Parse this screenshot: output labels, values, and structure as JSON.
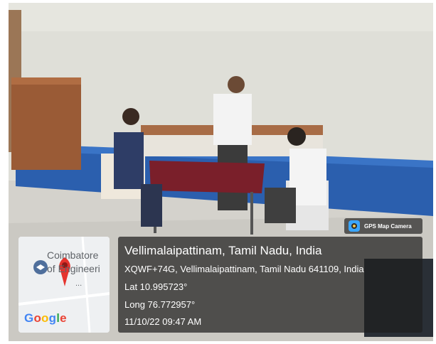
{
  "badge": {
    "label": "GPS Map Camera",
    "icon": "gps-map-camera-icon"
  },
  "map": {
    "place_line1": "Coimbatore",
    "place_line2": "of Engineeri",
    "dots": "...",
    "logo": [
      "G",
      "o",
      "o",
      "g",
      "l",
      "e"
    ],
    "logo_colors": [
      "#4285F4",
      "#EA4335",
      "#FBBC05",
      "#4285F4",
      "#34A853",
      "#EA4335"
    ],
    "pin_color": "#E5342E"
  },
  "info": {
    "title": "Vellimalaipattinam, Tamil Nadu, India",
    "address": "XQWF+74G, Vellimalaipattinam, Tamil Nadu 641109, India",
    "lat": "Lat 10.995723°",
    "long": "Long 76.772957°",
    "datetime": "11/10/22 09:47 AM"
  }
}
